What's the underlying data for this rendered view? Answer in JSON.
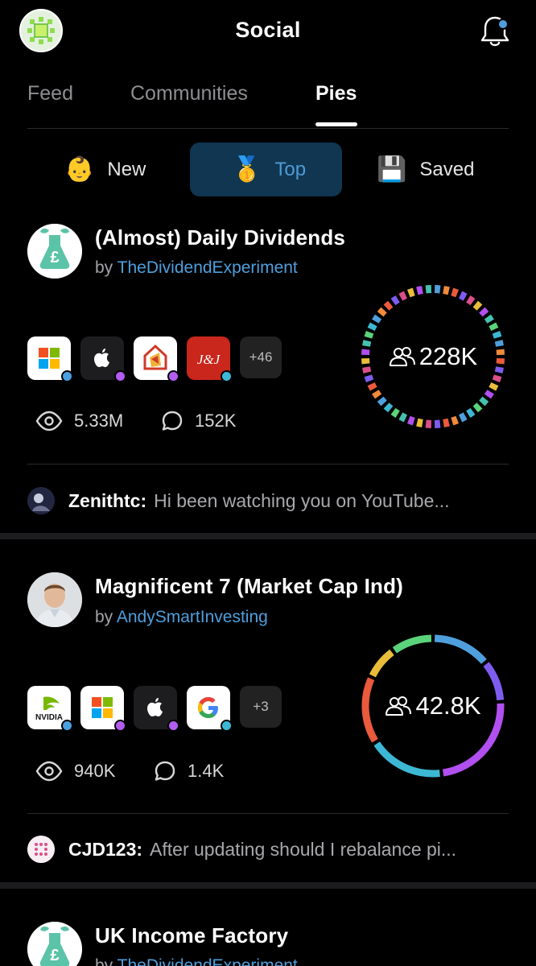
{
  "header": {
    "title": "Social",
    "avatar_icon": "pie-logo-icon",
    "bell_icon": "bell-icon"
  },
  "tabs": [
    {
      "label": "Feed",
      "active": false
    },
    {
      "label": "Communities",
      "active": false
    },
    {
      "label": "Pies",
      "active": true
    }
  ],
  "filters": [
    {
      "emoji": "👶",
      "label": "New",
      "active": false
    },
    {
      "emoji": "🥇",
      "label": "Top",
      "active": true
    },
    {
      "emoji": "💾",
      "label": "Saved",
      "active": false
    }
  ],
  "pies": [
    {
      "title": "(Almost) Daily Dividends",
      "by": "by",
      "author": "TheDividendExperiment",
      "holdings": [
        {
          "icon": "microsoft-icon",
          "dot_color": "#4a9fe0"
        },
        {
          "icon": "apple-icon",
          "dot_color": "#b25cf0"
        },
        {
          "icon": "realty-income-icon",
          "dot_color": "#b25cf0"
        },
        {
          "icon": "johnson-and-johnson-icon",
          "dot_color": "#3db8d4"
        }
      ],
      "more": "+46",
      "views": "5.33M",
      "comments": "152K",
      "followers": "228K",
      "comment": {
        "user": "Zenithtc:",
        "text": "Hi been watching you on YouTube..."
      }
    },
    {
      "title": "Magnificent 7 (Market Cap Ind)",
      "by": "by",
      "author": "AndySmartInvesting",
      "holdings": [
        {
          "icon": "nvidia-icon",
          "dot_color": "#4a9fe0"
        },
        {
          "icon": "microsoft-icon",
          "dot_color": "#b25cf0"
        },
        {
          "icon": "apple-icon",
          "dot_color": "#b25cf0"
        },
        {
          "icon": "google-icon",
          "dot_color": "#3db8d4"
        }
      ],
      "more": "+3",
      "views": "940K",
      "comments": "1.4K",
      "followers": "42.8K",
      "comment": {
        "user": "CJD123:",
        "text": "After updating should I rebalance pi..."
      }
    },
    {
      "title": "UK Income Factory",
      "by": "by",
      "author": "TheDividendExperiment"
    }
  ],
  "colors": {
    "accent": "#4f9fdd",
    "active_filter_bg": "#103651",
    "ring2_segments": [
      "#4f9fdd",
      "#7e5cf0",
      "#b14ff0",
      "#3db8d4",
      "#ea5a3c",
      "#e9bd3a",
      "#5bd37a"
    ]
  }
}
